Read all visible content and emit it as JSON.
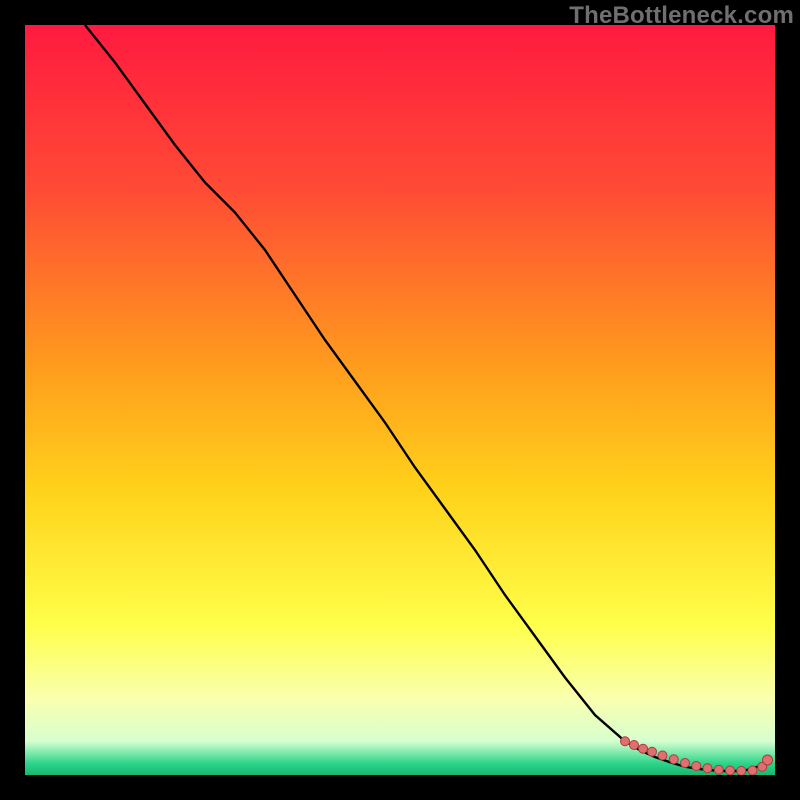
{
  "watermark": "TheBottleneck.com",
  "colors": {
    "bg_black": "#000000",
    "grad_top": "#ff1a3f",
    "grad_mid_upper": "#ff7a2a",
    "grad_mid": "#ffd21a",
    "grad_lower": "#ffff6a",
    "grad_pale": "#f6ffd0",
    "grad_green": "#2bd48a",
    "line": "#000000",
    "marker_fill": "#e07070",
    "marker_stroke": "#a83d3d"
  },
  "chart_data": {
    "type": "line",
    "title": "",
    "xlabel": "",
    "ylabel": "",
    "xlim": [
      0,
      100
    ],
    "ylim": [
      0,
      100
    ],
    "grid": false,
    "legend": false,
    "series": [
      {
        "name": "curve",
        "kind": "line",
        "x": [
          8,
          12,
          16,
          20,
          24,
          28,
          32,
          36,
          40,
          44,
          48,
          52,
          56,
          60,
          64,
          68,
          72,
          76,
          80,
          82,
          84,
          86,
          88,
          90,
          92,
          94,
          96,
          98,
          99
        ],
        "y": [
          100,
          95,
          89.5,
          84,
          79,
          75,
          70,
          64,
          58,
          52.5,
          47,
          41,
          35.5,
          30,
          24,
          18.5,
          13,
          8,
          4.5,
          3.3,
          2.4,
          1.7,
          1.1,
          0.8,
          0.6,
          0.5,
          0.6,
          1.2,
          2.0
        ]
      },
      {
        "name": "markers",
        "kind": "scatter",
        "x": [
          80,
          81.2,
          82.4,
          83.6,
          85,
          86.5,
          88,
          89.5,
          91,
          92.5,
          94,
          95.5,
          97,
          98.3,
          99
        ],
        "y": [
          4.5,
          4.0,
          3.5,
          3.1,
          2.6,
          2.1,
          1.6,
          1.2,
          0.9,
          0.7,
          0.6,
          0.55,
          0.6,
          1.1,
          2.0
        ]
      }
    ],
    "gradient_stops": [
      {
        "offset": 0.0,
        "color": "#ff1a3f"
      },
      {
        "offset": 0.22,
        "color": "#ff4b35"
      },
      {
        "offset": 0.45,
        "color": "#ff9a1e"
      },
      {
        "offset": 0.62,
        "color": "#ffd21a"
      },
      {
        "offset": 0.8,
        "color": "#ffff4a"
      },
      {
        "offset": 0.9,
        "color": "#f9ffb0"
      },
      {
        "offset": 0.955,
        "color": "#d6ffcf"
      },
      {
        "offset": 0.985,
        "color": "#2bd48a"
      },
      {
        "offset": 1.0,
        "color": "#18b86f"
      }
    ]
  }
}
